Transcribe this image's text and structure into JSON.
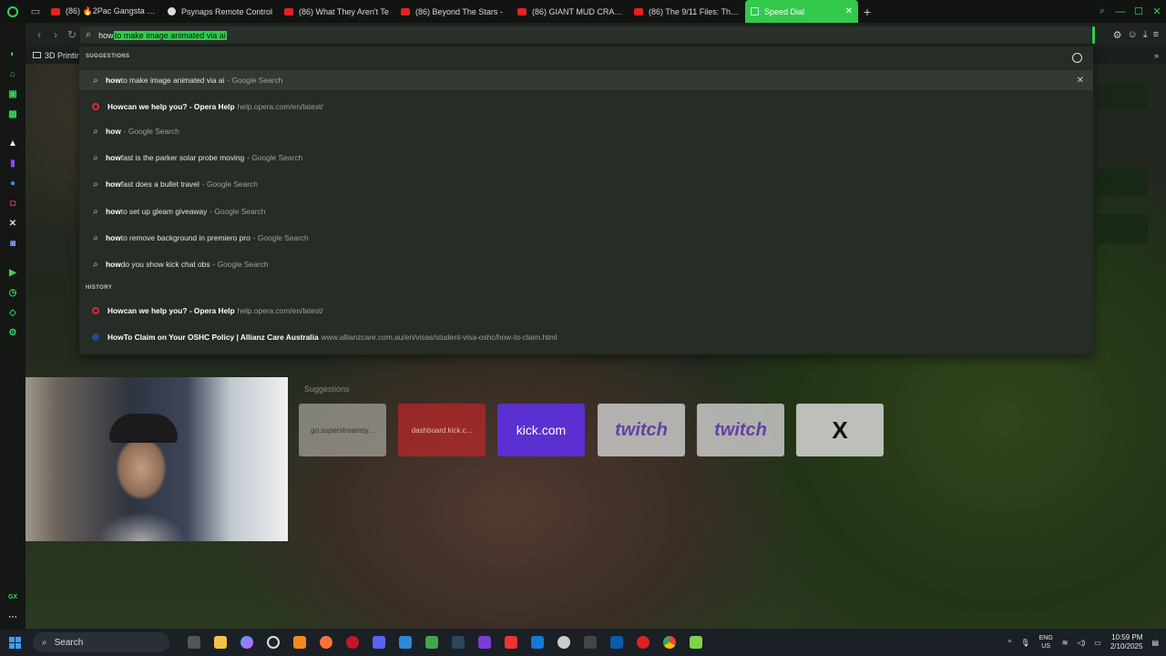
{
  "browser": {
    "tabs": [
      {
        "label": "(86) 🔥2Pac Gangsta Ra",
        "icon": "youtube-icon"
      },
      {
        "label": "Psynaps Remote Control",
        "icon": "globe-icon"
      },
      {
        "label": "(86) What They Aren't Te",
        "icon": "youtube-icon"
      },
      {
        "label": "(86) Beyond The Stars -",
        "icon": "youtube-icon"
      },
      {
        "label": "(86) GIANT MUD CRAB C",
        "icon": "youtube-icon"
      },
      {
        "label": "(86) The 9/11 Files: The C",
        "icon": "youtube-icon"
      },
      {
        "label": "Speed Dial",
        "icon": "speed-dial-icon",
        "active": true
      }
    ],
    "address": {
      "typed": "how",
      "autocomplete": " to make image animated via ai"
    },
    "bookmark_folder": "3D Printin"
  },
  "dropdown": {
    "suggestions_header": "SUGGESTIONS",
    "history_header": "HISTORY",
    "suggestions": [
      {
        "bold": "how",
        "rest": " to make image animated via ai",
        "suffix": "- Google Search",
        "icon": "search-icon"
      },
      {
        "bold": "How",
        "rest": " can we help you? - Opera Help",
        "suffix": "help.opera.com/en/latest/",
        "icon": "opera-icon"
      },
      {
        "bold": "how",
        "rest": "",
        "suffix": "- Google Search",
        "icon": "search-icon"
      },
      {
        "bold": "how",
        "rest": " fast is the parker solar probe moving",
        "suffix": "- Google Search",
        "icon": "search-icon"
      },
      {
        "bold": "how",
        "rest": " fast does a bullet travel",
        "suffix": "- Google Search",
        "icon": "search-icon"
      },
      {
        "bold": "how",
        "rest": " to set up gleam giveaway",
        "suffix": "- Google Search",
        "icon": "search-icon"
      },
      {
        "bold": "how",
        "rest": " to remove background in premiero pro",
        "suffix": "- Google Search",
        "icon": "search-icon"
      },
      {
        "bold": "how",
        "rest": " do you show kick chat obs",
        "suffix": "- Google Search",
        "icon": "search-icon"
      }
    ],
    "history": [
      {
        "bold": "How",
        "rest": " can we help you? - Opera Help",
        "suffix": "help.opera.com/en/latest/",
        "icon": "opera-icon"
      },
      {
        "bold": "How",
        "rest": " To Claim on Your OSHC Policy | Allianz Care Australia",
        "suffix": "www.allianzcare.com.au/en/visas/student-visa-oshc/how-to-claim.html",
        "icon": "allianz-icon"
      }
    ]
  },
  "speed_dial": {
    "label": "Suggestions",
    "tiles": [
      "go.superstreamsy...",
      "dashboard.kick.c...",
      "kick.com",
      "twitch",
      "twitch",
      "X"
    ]
  },
  "taskbar": {
    "search_placeholder": "Search",
    "lang_top": "ENG",
    "lang_bottom": "US",
    "time": "10:59 PM",
    "date": "2/10/2025"
  }
}
